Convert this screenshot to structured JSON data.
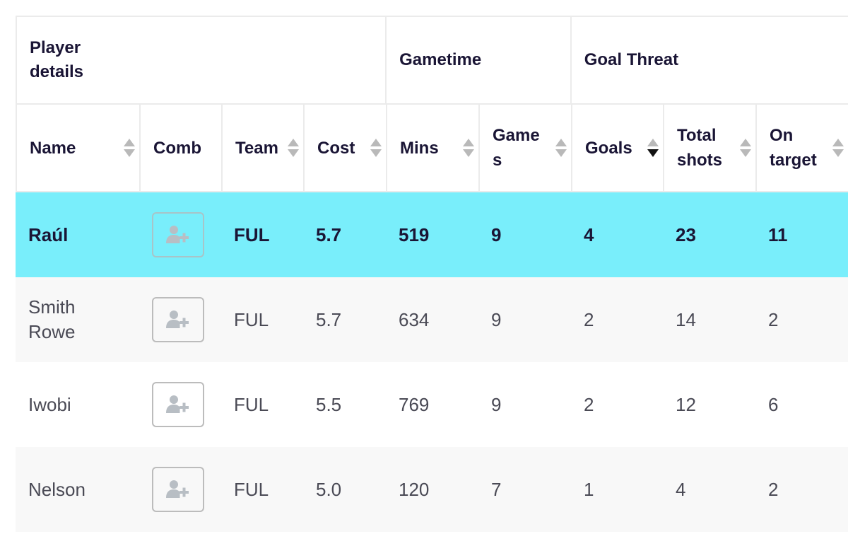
{
  "groups": {
    "player_details": "Player details",
    "gametime": "Gametime",
    "goal_threat": "Goal Threat"
  },
  "columns": {
    "name": "Name",
    "comb": "Comb",
    "team": "Team",
    "cost": "Cost",
    "mins": "Mins",
    "games": "Games",
    "goals": "Goals",
    "total_shots": "Total shots",
    "on_target": "On target"
  },
  "sort": {
    "column": "goals",
    "direction": "descending"
  },
  "colors": {
    "highlight_row": "#79eefb",
    "alt_row": "#f8f8f8",
    "header_text": "#1a1535",
    "body_text": "#4a4a55"
  },
  "rows": [
    {
      "name": "Raúl",
      "comb_icon": "add-user-icon",
      "team": "FUL",
      "cost": "5.7",
      "mins": "519",
      "games": "9",
      "goals": "4",
      "total_shots": "23",
      "on_target": "11",
      "highlighted": true
    },
    {
      "name": "Smith Rowe",
      "comb_icon": "add-user-icon",
      "team": "FUL",
      "cost": "5.7",
      "mins": "634",
      "games": "9",
      "goals": "2",
      "total_shots": "14",
      "on_target": "2",
      "highlighted": false
    },
    {
      "name": "Iwobi",
      "comb_icon": "add-user-icon",
      "team": "FUL",
      "cost": "5.5",
      "mins": "769",
      "games": "9",
      "goals": "2",
      "total_shots": "12",
      "on_target": "6",
      "highlighted": false
    },
    {
      "name": "Nelson",
      "comb_icon": "add-user-icon",
      "team": "FUL",
      "cost": "5.0",
      "mins": "120",
      "games": "7",
      "goals": "1",
      "total_shots": "4",
      "on_target": "2",
      "highlighted": false
    }
  ]
}
